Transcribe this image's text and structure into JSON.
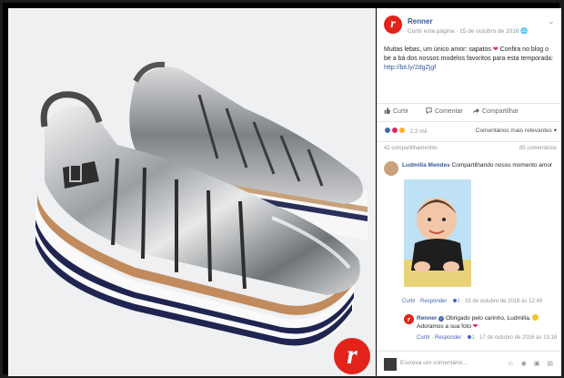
{
  "post": {
    "page_name": "Renner",
    "logo_letter": "r",
    "follow_link": "Curtir esta página",
    "separator": "·",
    "date": "15 de outubro de 2016",
    "globe": "🌐",
    "more": "⌄",
    "text_before_heart": "Muitas lebas, um único amor: sapatos",
    "heart": "❤",
    "text_after_heart": "Confira no blog o be a bá dos nossos modelos favoritos para esta temporada:",
    "link": "http://bit.ly/2dgZjgf"
  },
  "actions": {
    "like_label": "Curtir",
    "comment_label": "Comentar",
    "share_label": "Compartilhar"
  },
  "reactions": {
    "count": "2,2 mil",
    "relevance_label": "Comentários mais relevantes ▾"
  },
  "counts": {
    "shares": "42 compartilhamentos",
    "comments": "85 comentários"
  },
  "comment1": {
    "author": "Ludmilla Mendes",
    "text": "Compartilhando nosso momento amor",
    "like": "Curtir",
    "reply": "Responder",
    "dot": "·",
    "likes": "1",
    "time": "15 de outubro de 2016 às 12:46"
  },
  "reply1": {
    "author": "Renner",
    "verified": "✓",
    "text": "Obrigado pelo carinho, Ludmilla.",
    "text2": "Adoramos a sua foto",
    "heart": "❤",
    "like": "Curtir",
    "reply": "Responder",
    "dot": "·",
    "likes": "1",
    "time": "17 de outubro de 2016 às 13:18"
  },
  "composer": {
    "placeholder": "Escreva um comentário...",
    "icons": "☺ ◉ ▣ ▤"
  },
  "colors": {
    "brand": "#e2231a",
    "link": "#365899"
  }
}
